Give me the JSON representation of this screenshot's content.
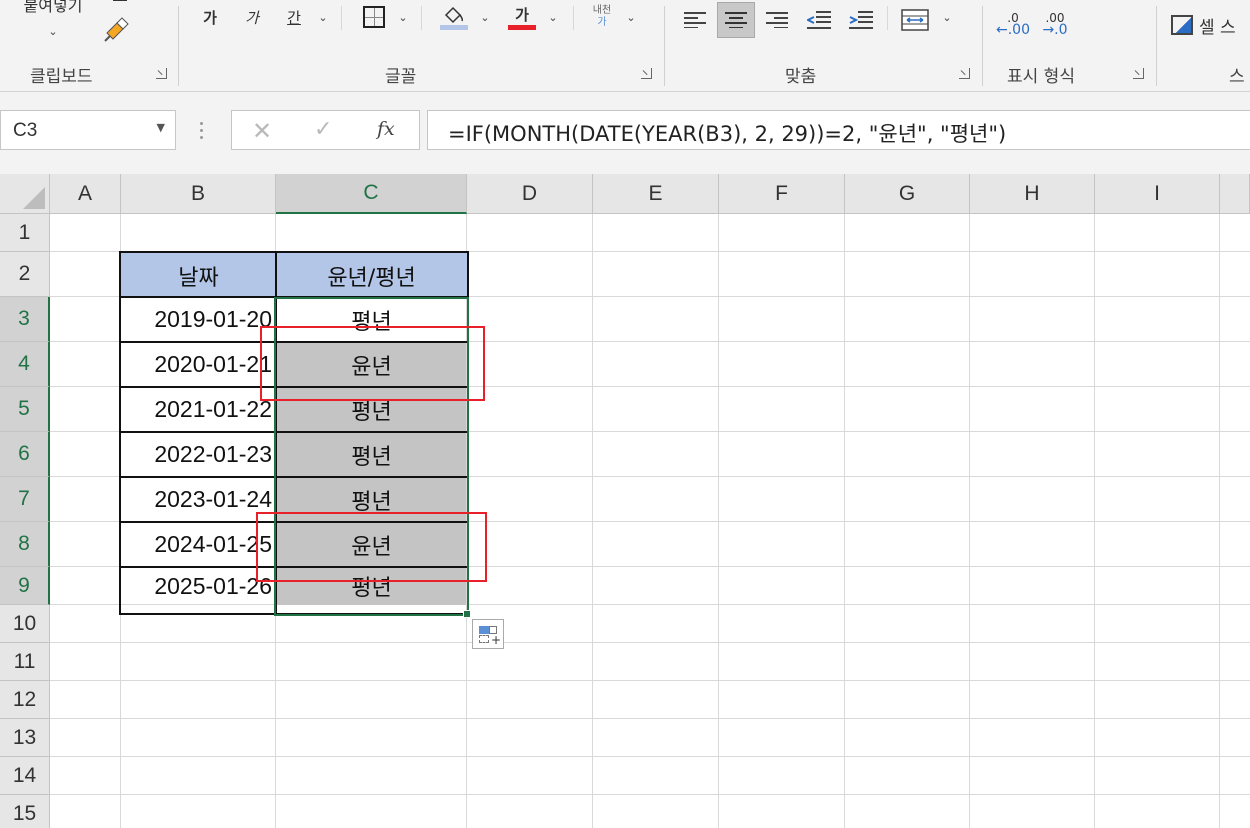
{
  "ribbon": {
    "clipboard": {
      "paste_label": "붙여넣기",
      "group_label": "클립보드"
    },
    "font": {
      "bold_glyph": "가",
      "italic_glyph": "가",
      "underline_glyph": "간",
      "font_color_glyph": "가",
      "phonetic_label_top": "내천",
      "phonetic_label_bottom": "가",
      "group_label": "글꼴"
    },
    "alignment": {
      "group_label": "맞춤"
    },
    "number": {
      "inc_decimal": ".0",
      "dec_decimal": ".00",
      "group_label": "표시 형식"
    },
    "styles": {
      "cell_styles_label": "셀 스",
      "group_label": "스"
    }
  },
  "formula_bar": {
    "name_box": "C3",
    "cancel_glyph": "✕",
    "enter_glyph": "✓",
    "fx_glyph": "fx",
    "formula": "=IF(MONTH(DATE(YEAR(B3), 2, 29))=2, \"윤년\", \"평년\")"
  },
  "columns": [
    "A",
    "B",
    "C",
    "D",
    "E",
    "F",
    "G",
    "H",
    "I"
  ],
  "selected_column": "C",
  "rows": [
    "1",
    "2",
    "3",
    "4",
    "5",
    "6",
    "7",
    "8",
    "9",
    "10",
    "11",
    "12",
    "13",
    "14",
    "15"
  ],
  "selected_rows": [
    "3",
    "4",
    "5",
    "6",
    "7",
    "8",
    "9"
  ],
  "table": {
    "header": {
      "date": "날짜",
      "type": "윤년/평년"
    },
    "rows": [
      {
        "date": "2019-01-20",
        "type": "평년"
      },
      {
        "date": "2020-01-21",
        "type": "윤년"
      },
      {
        "date": "2021-01-22",
        "type": "평년"
      },
      {
        "date": "2022-01-23",
        "type": "평년"
      },
      {
        "date": "2023-01-24",
        "type": "평년"
      },
      {
        "date": "2024-01-25",
        "type": "윤년"
      },
      {
        "date": "2025-01-26",
        "type": "평년"
      }
    ]
  },
  "colors": {
    "header_fill": "#b4c6e7",
    "selection_green": "#217346",
    "selected_fill": "#c4c4c4",
    "highlight_red": "#e8202a"
  }
}
